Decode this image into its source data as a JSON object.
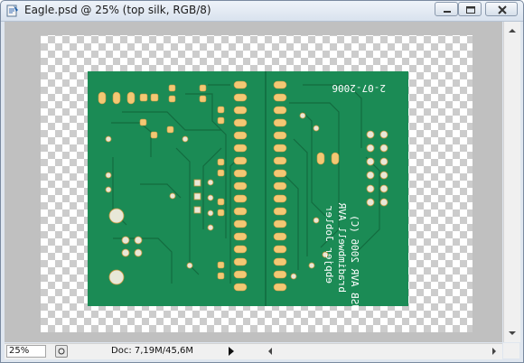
{
  "window": {
    "title": "Eagle.psd @ 25% (top silk, RGB/8)",
    "icons": [
      "photoshop-document-icon",
      "minimize-icon",
      "maximize-icon",
      "close-icon"
    ]
  },
  "status": {
    "zoom": "25%",
    "doc_info": "Doc: 7,19M/45,6M"
  },
  "board": {
    "silk_text_lines": [
      "USB AVR 2006 (C)",
      "bradimbwell AVR",
      "ebpjer Jobler"
    ],
    "silk_date": "2-07-2006",
    "colors": {
      "board": "#1b8b55",
      "trace": "#136b3f",
      "pad": "#f3c874",
      "silk": "#ffffff",
      "checker": "#cccccc"
    }
  }
}
